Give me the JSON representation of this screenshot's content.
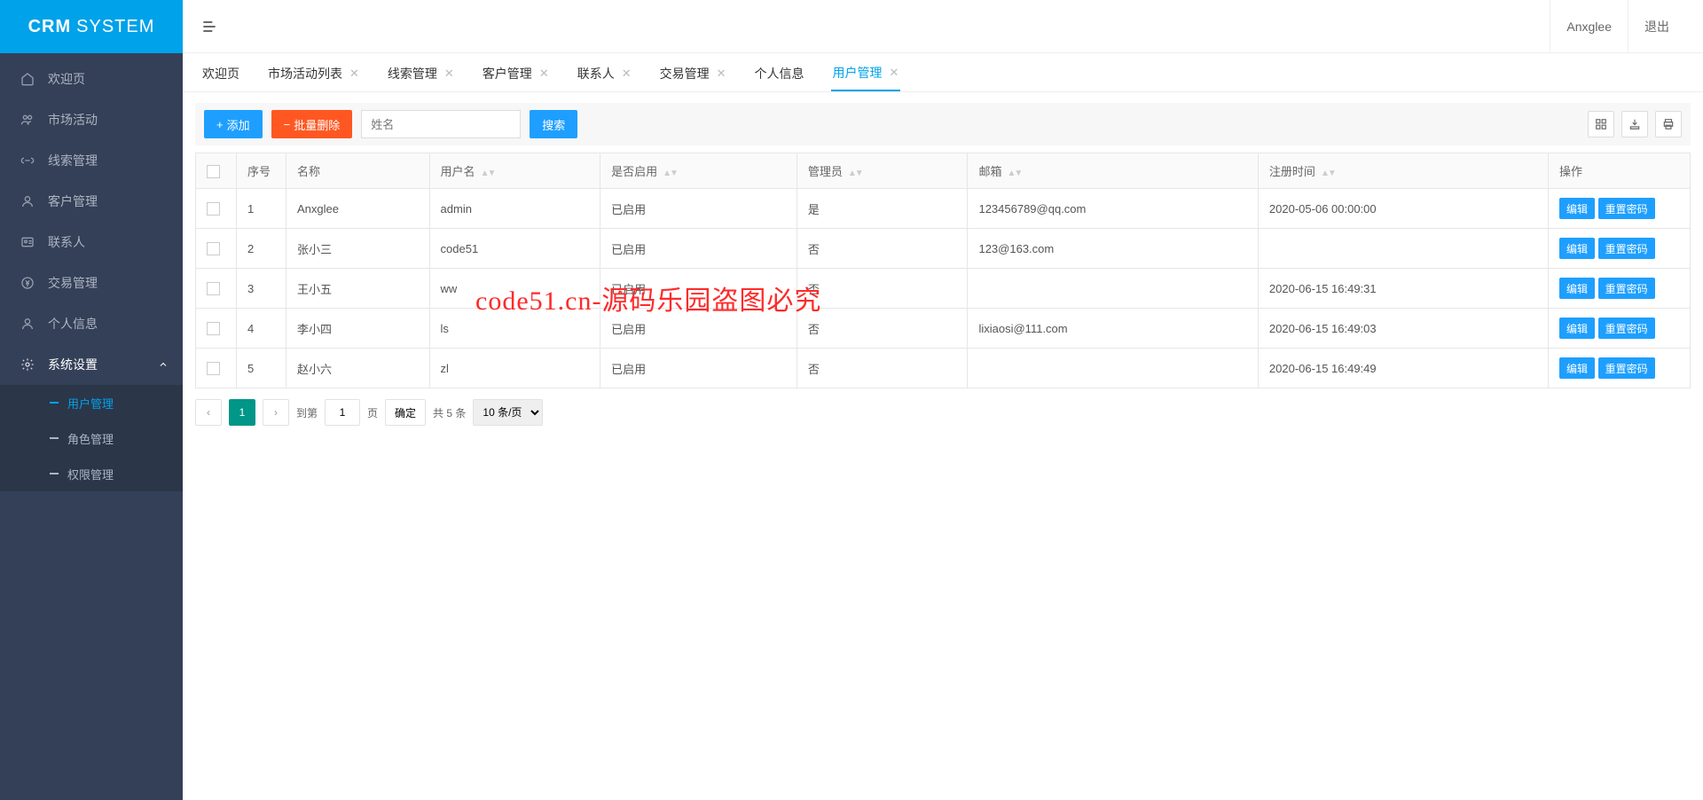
{
  "brand": {
    "bold": "CRM",
    "light": "SYSTEM"
  },
  "header": {
    "username": "Anxglee",
    "logout": "退出"
  },
  "sidebar": {
    "items": [
      {
        "label": "欢迎页"
      },
      {
        "label": "市场活动"
      },
      {
        "label": "线索管理"
      },
      {
        "label": "客户管理"
      },
      {
        "label": "联系人"
      },
      {
        "label": "交易管理"
      },
      {
        "label": "个人信息"
      },
      {
        "label": "系统设置"
      }
    ],
    "settings_children": [
      {
        "label": "用户管理"
      },
      {
        "label": "角色管理"
      },
      {
        "label": "权限管理"
      }
    ]
  },
  "tabs": [
    {
      "label": "欢迎页",
      "closable": false
    },
    {
      "label": "市场活动列表",
      "closable": true
    },
    {
      "label": "线索管理",
      "closable": true
    },
    {
      "label": "客户管理",
      "closable": true
    },
    {
      "label": "联系人",
      "closable": true
    },
    {
      "label": "交易管理",
      "closable": true
    },
    {
      "label": "个人信息",
      "closable": true
    },
    {
      "label": "用户管理",
      "closable": true,
      "active": true
    }
  ],
  "toolbar": {
    "add": "添加",
    "batch_delete": "批量删除",
    "name_placeholder": "姓名",
    "search": "搜索"
  },
  "columns": {
    "index": "序号",
    "name": "名称",
    "username": "用户名",
    "enabled": "是否启用",
    "admin": "管理员",
    "email": "邮箱",
    "reg_time": "注册时间",
    "ops": "操作"
  },
  "ops": {
    "edit": "编辑",
    "reset_pwd": "重置密码"
  },
  "rows": [
    {
      "idx": "1",
      "name": "Anxglee",
      "username": "admin",
      "enabled": "已启用",
      "admin": "是",
      "email": "123456789@qq.com",
      "reg_time": "2020-05-06 00:00:00"
    },
    {
      "idx": "2",
      "name": "张小三",
      "username": "code51",
      "enabled": "已启用",
      "admin": "否",
      "email": "123@163.com",
      "reg_time": ""
    },
    {
      "idx": "3",
      "name": "王小五",
      "username": "ww",
      "enabled": "已启用",
      "admin": "否",
      "email": "",
      "reg_time": "2020-06-15 16:49:31"
    },
    {
      "idx": "4",
      "name": "李小四",
      "username": "ls",
      "enabled": "已启用",
      "admin": "否",
      "email": "lixiaosi@111.com",
      "reg_time": "2020-06-15 16:49:03"
    },
    {
      "idx": "5",
      "name": "赵小六",
      "username": "zl",
      "enabled": "已启用",
      "admin": "否",
      "email": "",
      "reg_time": "2020-06-15 16:49:49"
    }
  ],
  "pager": {
    "goto_label": "到第",
    "page_label": "页",
    "confirm": "确定",
    "total_label": "共 5 条",
    "page_size": "10 条/页",
    "current_page": "1",
    "goto_value": "1"
  },
  "watermark": "code51.cn-源码乐园盗图必究"
}
